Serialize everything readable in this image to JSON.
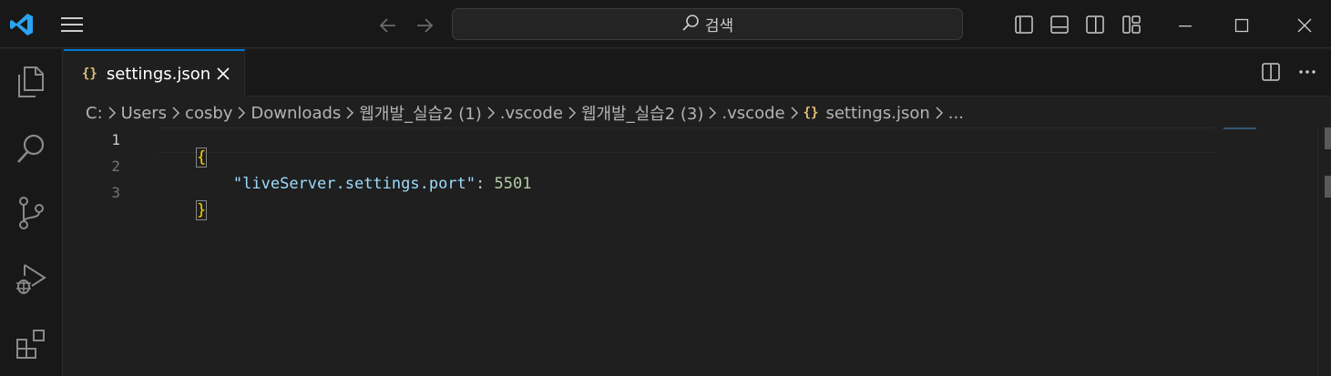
{
  "titlebar": {
    "search_text": "검색"
  },
  "tab": {
    "icon_glyph": "{}",
    "title": "settings.json"
  },
  "breadcrumb": [
    "C:",
    "Users",
    "cosby",
    "Downloads",
    "웹개발_실습2 (1)",
    ".vscode",
    "웹개발_실습2 (3)",
    ".vscode",
    "settings.json",
    "..."
  ],
  "editor": {
    "lines": [
      {
        "num": "1",
        "text": "{"
      },
      {
        "num": "2",
        "key": "\"liveServer.settings.port\"",
        "sep": ": ",
        "value": "5501"
      },
      {
        "num": "3",
        "text": "}"
      }
    ]
  },
  "colors": {
    "accent": "#0078d4",
    "brace": "#ffd700",
    "key": "#9cdcfe",
    "number": "#b5cea8",
    "background": "#1f1f1f"
  },
  "icons": [
    "vscode-logo-icon",
    "menu-icon",
    "arrow-left-icon",
    "arrow-right-icon",
    "search-icon",
    "toggle-primary-sidebar-icon",
    "toggle-panel-icon",
    "toggle-secondary-sidebar-icon",
    "customize-layout-icon",
    "minimize-icon",
    "maximize-icon",
    "close-icon",
    "explorer-icon",
    "search-view-icon",
    "source-control-icon",
    "run-debug-icon",
    "extensions-icon",
    "json-icon",
    "split-editor-icon",
    "more-actions-icon",
    "chevron-right-icon"
  ]
}
